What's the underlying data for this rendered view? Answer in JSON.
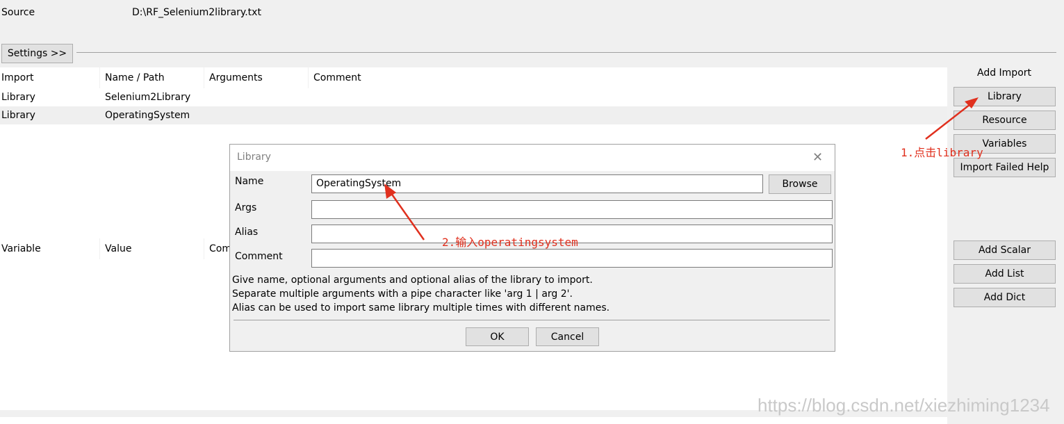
{
  "source": {
    "label": "Source",
    "value": "D:\\RF_Selenium2library.txt"
  },
  "settings_button": "Settings >>",
  "imports_table": {
    "headers": [
      "Import",
      "Name / Path",
      "Arguments",
      "Comment"
    ],
    "rows": [
      {
        "type": "Library",
        "name": "Selenium2Library"
      },
      {
        "type": "Library",
        "name": "OperatingSystem"
      }
    ]
  },
  "import_buttons": {
    "title": "Add Import",
    "library": "Library",
    "resource": "Resource",
    "variables": "Variables",
    "import_failed_help": "Import Failed Help"
  },
  "variables_table": {
    "headers": [
      "Variable",
      "Value",
      "Com"
    ]
  },
  "variable_buttons": {
    "add_scalar": "Add Scalar",
    "add_list": "Add List",
    "add_dict": "Add Dict"
  },
  "dialog": {
    "title": "Library",
    "close_symbol": "✕",
    "name_label": "Name",
    "name_value": "OperatingSystem",
    "browse_label": "Browse",
    "args_label": "Args",
    "alias_label": "Alias",
    "comment_label": "Comment",
    "help_line1": "Give name, optional arguments and optional alias of the library to import.",
    "help_line2": "Separate multiple arguments with a pipe character like 'arg 1 | arg 2'.",
    "help_line3": "Alias can be used to import same library multiple times with different names.",
    "ok_label": "OK",
    "cancel_label": "Cancel"
  },
  "annotations": {
    "step1": "1.点击library",
    "step2": "2.输入operatingsystem",
    "color": "#e0301e"
  },
  "watermark": "https://blog.csdn.net/xiezhiming1234"
}
